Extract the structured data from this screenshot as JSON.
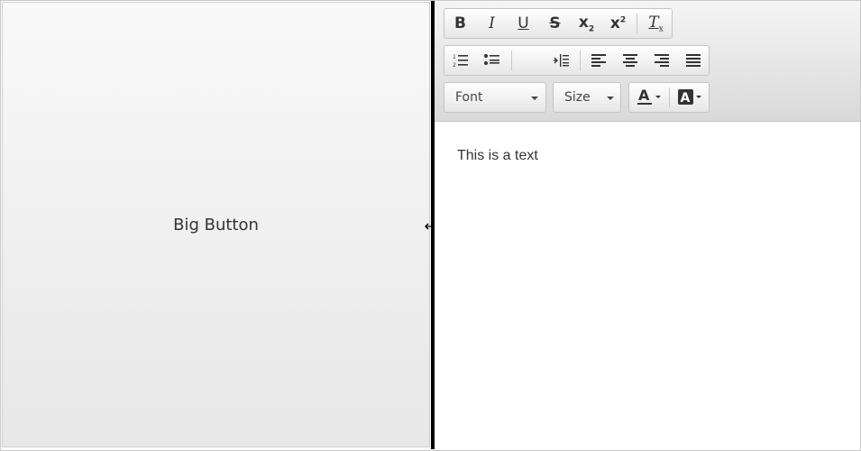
{
  "left_panel": {
    "big_button_label": "Big Button"
  },
  "editor": {
    "toolbar": {
      "row1": [
        {
          "name": "bold-button",
          "icon": "bold-icon",
          "glyph": "B"
        },
        {
          "name": "italic-button",
          "icon": "italic-icon",
          "glyph": "I"
        },
        {
          "name": "underline-button",
          "icon": "underline-icon",
          "glyph": "U"
        },
        {
          "name": "strikethrough-button",
          "icon": "strikethrough-icon",
          "glyph": "S"
        },
        {
          "name": "subscript-button",
          "icon": "subscript-icon",
          "glyph": "x2"
        },
        {
          "name": "superscript-button",
          "icon": "superscript-icon",
          "glyph": "x2"
        },
        {
          "name": "clear-format-button",
          "icon": "clear-format-icon",
          "glyph": "Tx"
        }
      ],
      "row2": [
        {
          "name": "ordered-list-button",
          "icon": "ordered-list-icon"
        },
        {
          "name": "unordered-list-button",
          "icon": "unordered-list-icon"
        },
        {
          "name": "indent-button",
          "icon": "indent-icon"
        },
        {
          "name": "align-left-button",
          "icon": "align-left-icon"
        },
        {
          "name": "align-center-button",
          "icon": "align-center-icon"
        },
        {
          "name": "align-right-button",
          "icon": "align-right-icon"
        },
        {
          "name": "justify-button",
          "icon": "justify-icon"
        }
      ],
      "font_label": "Font",
      "size_label": "Size",
      "text_color_icon": "text-color-icon",
      "highlight_icon": "background-color-icon"
    },
    "content_text": "This is a text"
  },
  "colors": {
    "splitter": "#000000",
    "toolbar_bg": "#e0e0e0",
    "text": "#333333"
  }
}
